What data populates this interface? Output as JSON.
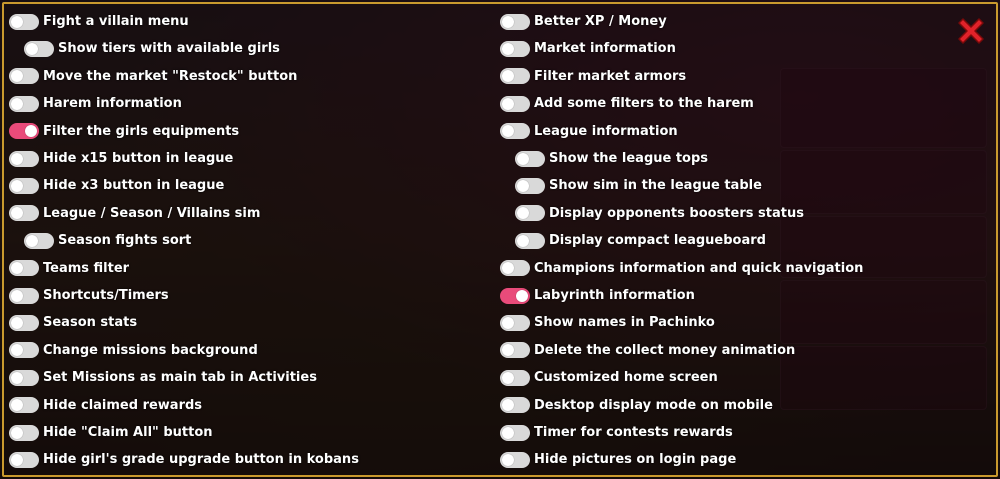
{
  "window": {
    "close_icon": "close-x-icon",
    "frame_color": "#c99a2e"
  },
  "colors": {
    "toggle_on": "#e94b7a",
    "toggle_off": "#d9d9d9",
    "text": "#ffffff",
    "close": "#e0222a"
  },
  "left_options": [
    {
      "label": "Fight a villain menu",
      "on": false,
      "sub": false
    },
    {
      "label": "Show tiers with available girls",
      "on": false,
      "sub": true
    },
    {
      "label": "Move the market \"Restock\" button",
      "on": false,
      "sub": false
    },
    {
      "label": "Harem information",
      "on": false,
      "sub": false
    },
    {
      "label": "Filter the girls equipments",
      "on": true,
      "sub": false
    },
    {
      "label": "Hide x15 button in league",
      "on": false,
      "sub": false
    },
    {
      "label": "Hide x3 button in league",
      "on": false,
      "sub": false
    },
    {
      "label": "League / Season / Villains sim",
      "on": false,
      "sub": false
    },
    {
      "label": "Season fights sort",
      "on": false,
      "sub": true
    },
    {
      "label": "Teams filter",
      "on": false,
      "sub": false
    },
    {
      "label": "Shortcuts/Timers",
      "on": false,
      "sub": false
    },
    {
      "label": "Season stats",
      "on": false,
      "sub": false
    },
    {
      "label": "Change missions background",
      "on": false,
      "sub": false
    },
    {
      "label": "Set Missions as main tab in Activities",
      "on": false,
      "sub": false
    },
    {
      "label": "Hide claimed rewards",
      "on": false,
      "sub": false
    },
    {
      "label": "Hide \"Claim All\" button",
      "on": false,
      "sub": false
    },
    {
      "label": "Hide girl's grade upgrade button in kobans",
      "on": false,
      "sub": false
    }
  ],
  "right_options": [
    {
      "label": "Better XP / Money",
      "on": false,
      "sub": false
    },
    {
      "label": "Market information",
      "on": false,
      "sub": false
    },
    {
      "label": "Filter market armors",
      "on": false,
      "sub": false
    },
    {
      "label": "Add some filters to the harem",
      "on": false,
      "sub": false
    },
    {
      "label": "League information",
      "on": false,
      "sub": false
    },
    {
      "label": "Show the league tops",
      "on": false,
      "sub": true
    },
    {
      "label": "Show sim in the league table",
      "on": false,
      "sub": true
    },
    {
      "label": "Display opponents boosters status",
      "on": false,
      "sub": true
    },
    {
      "label": "Display compact leagueboard",
      "on": false,
      "sub": true
    },
    {
      "label": "Champions information and quick navigation",
      "on": false,
      "sub": false
    },
    {
      "label": "Labyrinth information",
      "on": true,
      "sub": false
    },
    {
      "label": "Show names in Pachinko",
      "on": false,
      "sub": false
    },
    {
      "label": "Delete the collect money animation",
      "on": false,
      "sub": false
    },
    {
      "label": "Customized home screen",
      "on": false,
      "sub": false
    },
    {
      "label": "Desktop display mode on mobile",
      "on": false,
      "sub": false
    },
    {
      "label": "Timer for contests rewards",
      "on": false,
      "sub": false
    },
    {
      "label": "Hide pictures on login page",
      "on": false,
      "sub": false
    }
  ]
}
